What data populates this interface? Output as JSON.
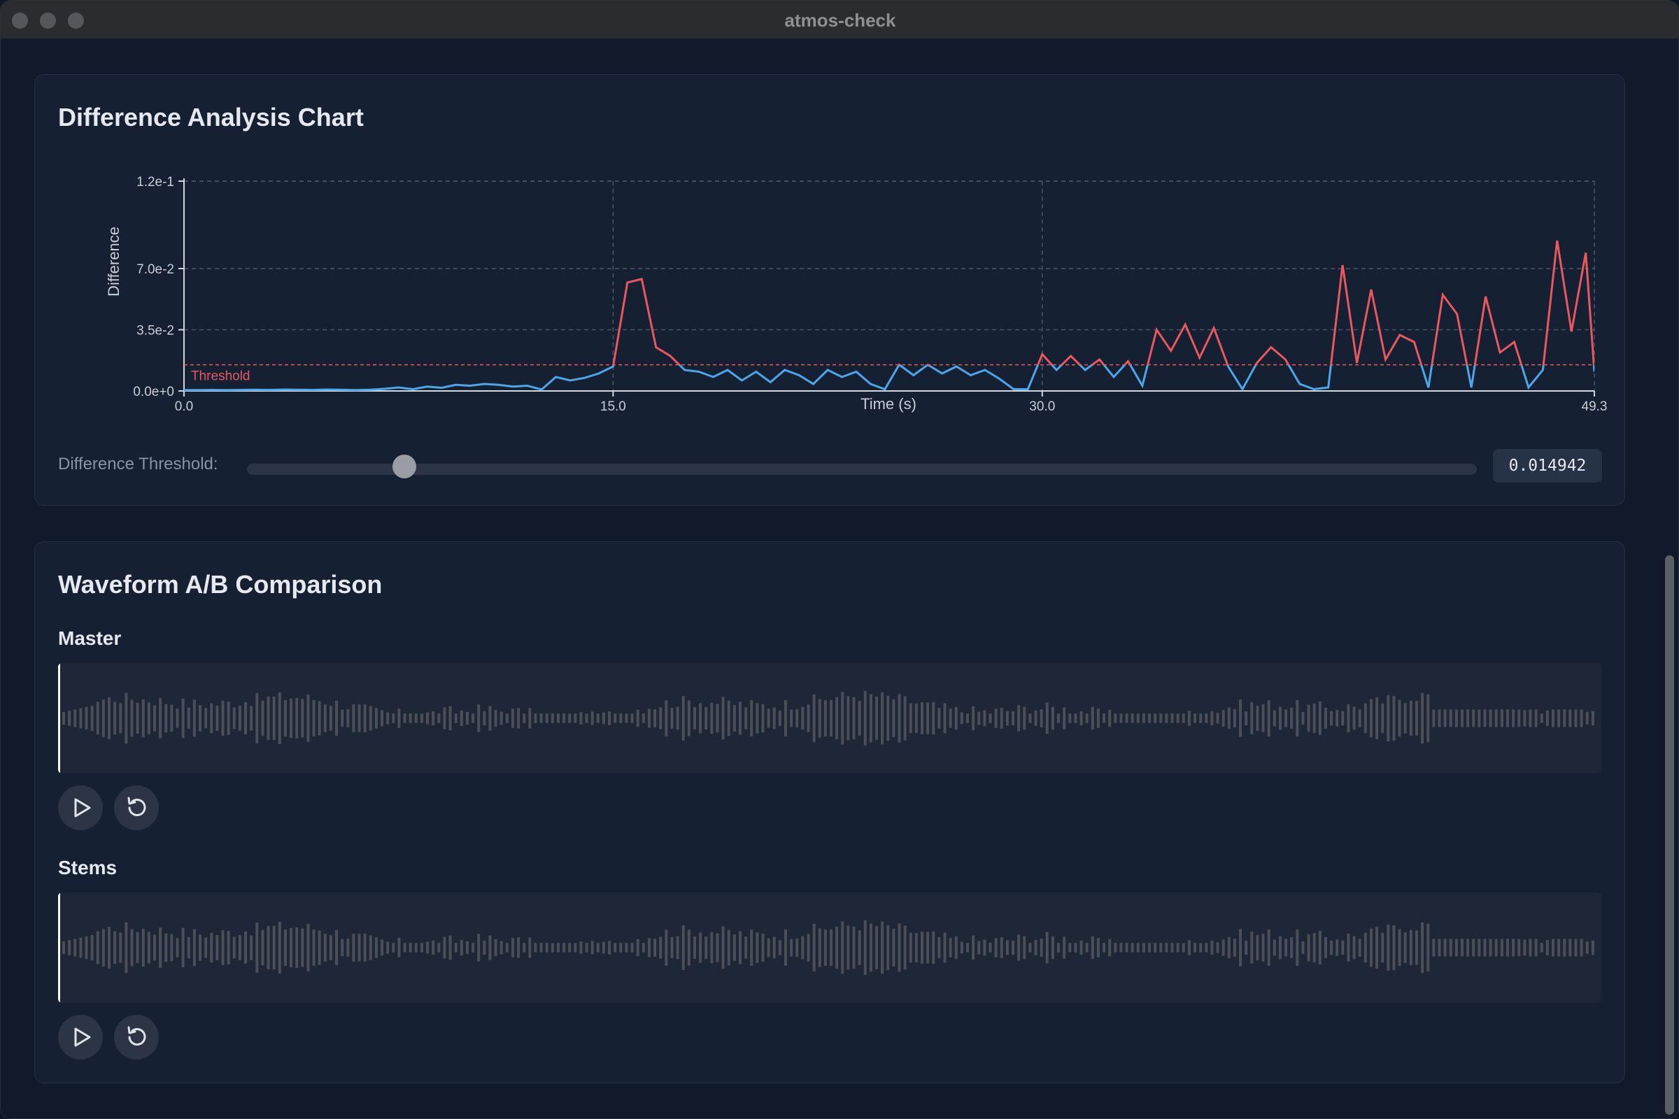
{
  "window": {
    "title": "atmos-check"
  },
  "difference_panel": {
    "title": "Difference Analysis Chart",
    "threshold_label": "Difference Threshold:",
    "threshold_value": "0.014942",
    "threshold_fraction": 0.128
  },
  "waveform_panel": {
    "title": "Waveform A/B Comparison",
    "tracks": [
      {
        "label": "Master",
        "playhead_fraction": 0.0
      },
      {
        "label": "Stems",
        "playhead_fraction": 0.0
      }
    ]
  },
  "colors": {
    "above_threshold": "#e8585e",
    "below_threshold": "#4ea6ea",
    "threshold_line": "#e8585e",
    "waveform_bar": "#4a4f58",
    "grid": "#4a5568"
  },
  "icons": {
    "play": "play-icon",
    "restart": "restart-icon"
  },
  "chart_data": {
    "type": "line",
    "title": "Difference Analysis Chart",
    "xlabel": "Time (s)",
    "ylabel": "Difference",
    "xlim": [
      0,
      49.3
    ],
    "ylim": [
      0,
      0.12
    ],
    "x_ticks": [
      "0.0",
      "15.0",
      "30.0",
      "49.3"
    ],
    "y_ticks": [
      "1.2e-1",
      "7.0e-2",
      "3.5e-2",
      "0.0e+0"
    ],
    "x_tick_values": [
      0,
      15,
      30,
      49.3
    ],
    "y_tick_values": [
      0.12,
      0.07,
      0.035,
      0
    ],
    "grid": true,
    "threshold": {
      "label": "Threshold",
      "value": 0.014942
    },
    "series": [
      {
        "x": [
          0,
          0.5,
          1,
          1.5,
          2,
          2.5,
          3,
          3.5,
          4,
          4.5,
          5,
          5.5,
          6,
          6.5,
          7,
          7.5,
          8,
          8.5,
          9,
          9.5,
          10,
          10.5,
          11,
          11.5,
          12,
          12.5,
          13,
          13.5,
          14,
          14.5,
          15,
          15.5,
          16,
          16.5,
          17,
          17.5,
          18,
          18.5,
          19,
          19.5,
          20,
          20.5,
          21,
          21.5,
          22,
          22.5,
          23,
          23.5,
          24,
          24.5,
          25,
          25.5,
          26,
          26.5,
          27,
          27.5,
          28,
          28.5,
          29,
          29.5,
          30,
          30.5,
          31,
          31.5,
          32,
          32.5,
          33,
          33.5,
          34,
          34.5,
          35,
          35.5,
          36,
          36.5,
          37,
          37.5,
          38,
          38.5,
          39,
          39.5,
          40,
          40.5,
          41,
          41.5,
          42,
          42.5,
          43,
          43.5,
          44,
          44.5,
          45,
          45.5,
          46,
          46.5,
          47,
          47.5,
          48,
          48.5,
          49,
          49.3
        ],
        "values": [
          0.0005,
          0.0005,
          0.0006,
          0.0005,
          0.0006,
          0.0007,
          0.0006,
          0.0008,
          0.0007,
          0.0006,
          0.0008,
          0.0007,
          0.0005,
          0.0007,
          0.0012,
          0.002,
          0.001,
          0.0025,
          0.0018,
          0.0035,
          0.003,
          0.004,
          0.0035,
          0.0025,
          0.003,
          0.0008,
          0.008,
          0.006,
          0.0075,
          0.01,
          0.014,
          0.062,
          0.064,
          0.025,
          0.02,
          0.012,
          0.011,
          0.008,
          0.012,
          0.006,
          0.011,
          0.005,
          0.012,
          0.009,
          0.004,
          0.012,
          0.008,
          0.011,
          0.004,
          0.001,
          0.015,
          0.009,
          0.015,
          0.01,
          0.014,
          0.009,
          0.012,
          0.007,
          0.001,
          0.001,
          0.021,
          0.012,
          0.02,
          0.012,
          0.018,
          0.008,
          0.017,
          0.003,
          0.035,
          0.023,
          0.038,
          0.019,
          0.036,
          0.014,
          0.001,
          0.016,
          0.025,
          0.018,
          0.004,
          0.001,
          0.002,
          0.072,
          0.016,
          0.058,
          0.018,
          0.032,
          0.028,
          0.002,
          0.055,
          0.044,
          0.002,
          0.054,
          0.022,
          0.028,
          0.002,
          0.012,
          0.086,
          0.034,
          0.079,
          0.011
        ],
        "values_note": "approximate envelope read from plot"
      }
    ]
  }
}
